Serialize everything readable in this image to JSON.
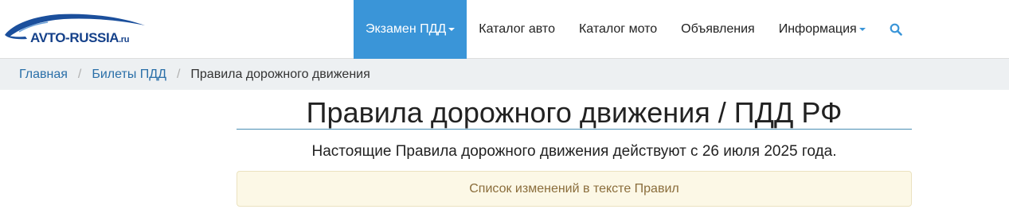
{
  "header": {
    "logo": {
      "name": "AVTO-RUSSIA",
      "tld": ".ru"
    },
    "nav": {
      "items": [
        {
          "label": "Экзамен ПДД",
          "has_dropdown": true,
          "active": true
        },
        {
          "label": "Каталог авто"
        },
        {
          "label": "Каталог мото"
        },
        {
          "label": "Объявления"
        },
        {
          "label": "Информация",
          "has_dropdown": true
        }
      ],
      "search_icon": "search-icon"
    }
  },
  "breadcrumb": {
    "items": [
      "Главная",
      "Билеты ПДД"
    ],
    "current": "Правила дорожного движения"
  },
  "main": {
    "title": "Правила дорожного движения / ПДД РФ",
    "notice": "Настоящие Правила дорожного движения действуют с 26 июля 2025 года.",
    "changes_link": "Список изменений в тексте Правил"
  },
  "colors": {
    "accent": "#3a95d8",
    "breadcrumb_bg": "#edf0f2",
    "link": "#2a6fa8",
    "alert_bg": "#fcf8e6",
    "alert_text": "#8a6d3b",
    "logo_blue": "#15418a"
  }
}
